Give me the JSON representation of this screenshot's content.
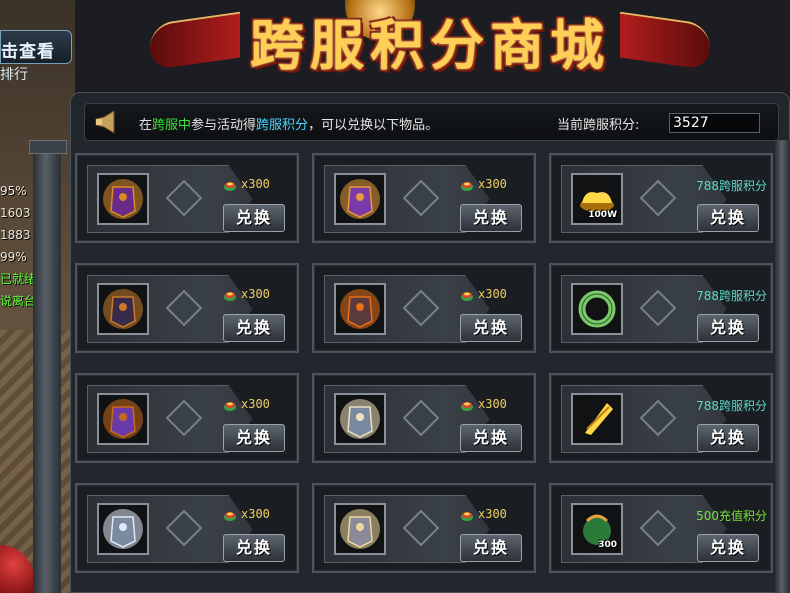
{
  "title": "跨服积分商城",
  "left_panel": {
    "button_label": "击查看",
    "button_sub": "排行",
    "stats": [
      "95%",
      "1603",
      "1883",
      "99%",
      "已就绪",
      "说离台"
    ]
  },
  "info_bar": {
    "prefix": "在",
    "highlight1": "跨服中",
    "middle": "参与活动得",
    "highlight2": "跨服积分",
    "suffix": "，可以兑换以下物品。",
    "points_label": "当前跨服积分:",
    "points_value": "3527"
  },
  "colors": {
    "green": "#39e03a",
    "cyan": "#4ad6ff",
    "gold": "#f0d060",
    "points_teal": "#5fd8c8",
    "recharge_green": "#79e23a"
  },
  "items": [
    {
      "icon": "purple-armor-icon",
      "cost": "x300",
      "button": "兑换"
    },
    {
      "icon": "purple-bracer-icon",
      "cost": "x300",
      "button": "兑换"
    },
    {
      "icon": "gold-ingot-icon",
      "cost": "788跨服积分",
      "button": "兑换",
      "badge": "100W"
    },
    {
      "icon": "dark-helmet-icon",
      "cost": "x300",
      "button": "兑换"
    },
    {
      "icon": "fire-ring-icon",
      "cost": "x300",
      "button": "兑换"
    },
    {
      "icon": "jade-pendant-icon",
      "cost": "788跨服积分",
      "button": "兑换"
    },
    {
      "icon": "purple-necklace-icon",
      "cost": "x300",
      "button": "兑换"
    },
    {
      "icon": "silver-armor-icon",
      "cost": "x300",
      "button": "兑换"
    },
    {
      "icon": "gold-feather-icon",
      "cost": "788跨服积分",
      "button": "兑换"
    },
    {
      "icon": "silver-boots-icon",
      "cost": "x300",
      "button": "兑换"
    },
    {
      "icon": "silver-medal-icon",
      "cost": "x300",
      "button": "兑换"
    },
    {
      "icon": "gem-pouch-icon",
      "cost": "500充值积分",
      "button": "兑换",
      "badge": "300"
    }
  ]
}
